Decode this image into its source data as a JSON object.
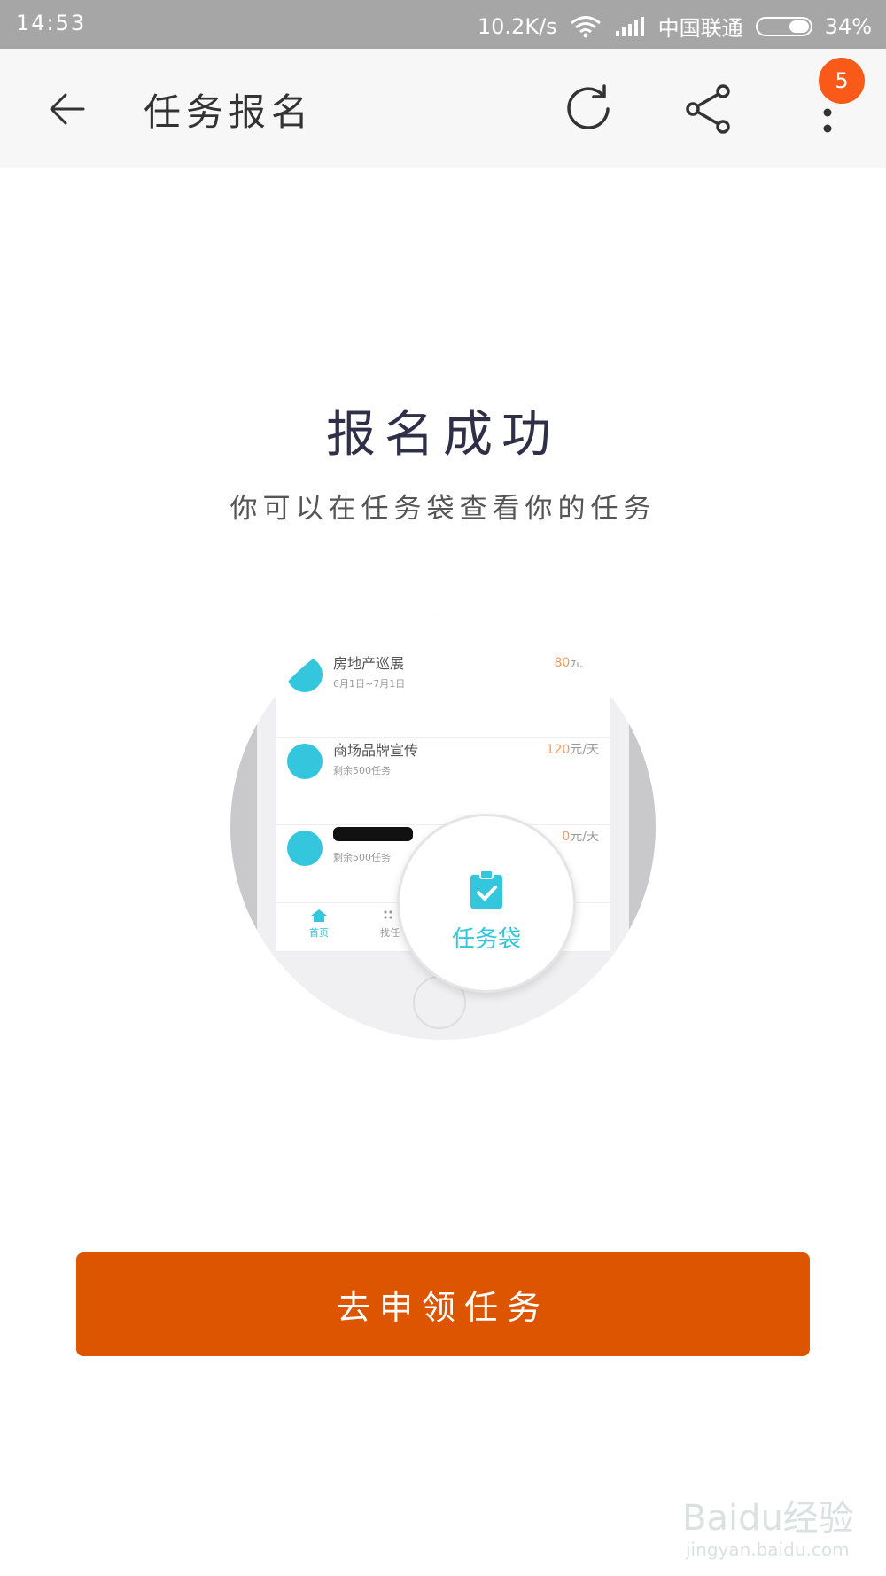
{
  "status_bar": {
    "time": "14:53",
    "network_speed": "10.2K/s",
    "carrier": "中国联通",
    "battery": "34%"
  },
  "header": {
    "title": "任务报名",
    "badge_count": "5",
    "icons": [
      "back-arrow-icon",
      "refresh-icon",
      "share-icon",
      "more-vert-icon"
    ]
  },
  "main": {
    "headline": "报名成功",
    "subtitle": "你可以在任务袋查看你的任务"
  },
  "illustration": {
    "tasks": [
      {
        "title": "房地产巡展",
        "sub": "6月1日~7月1日",
        "price_num": "80",
        "price_unit": "元/天"
      },
      {
        "title": "商场品牌宣传",
        "sub": "剩余500任务",
        "price_num": "120",
        "price_unit": "元/天"
      },
      {
        "title": "",
        "sub": "剩余500任务",
        "price_num": "0",
        "price_unit": "元/天"
      }
    ],
    "tabs": {
      "home": "首页",
      "find": "找任"
    },
    "magnified_label": "任务袋"
  },
  "cta": {
    "label": "去申领任务"
  },
  "watermark": {
    "logo": "Baidu经验",
    "url": "jingyan.baidu.com"
  },
  "colors": {
    "accent": "#dd5500",
    "badge": "#f95a1a",
    "teal": "#34c6dc",
    "statusbar": "#a6a6a6"
  }
}
